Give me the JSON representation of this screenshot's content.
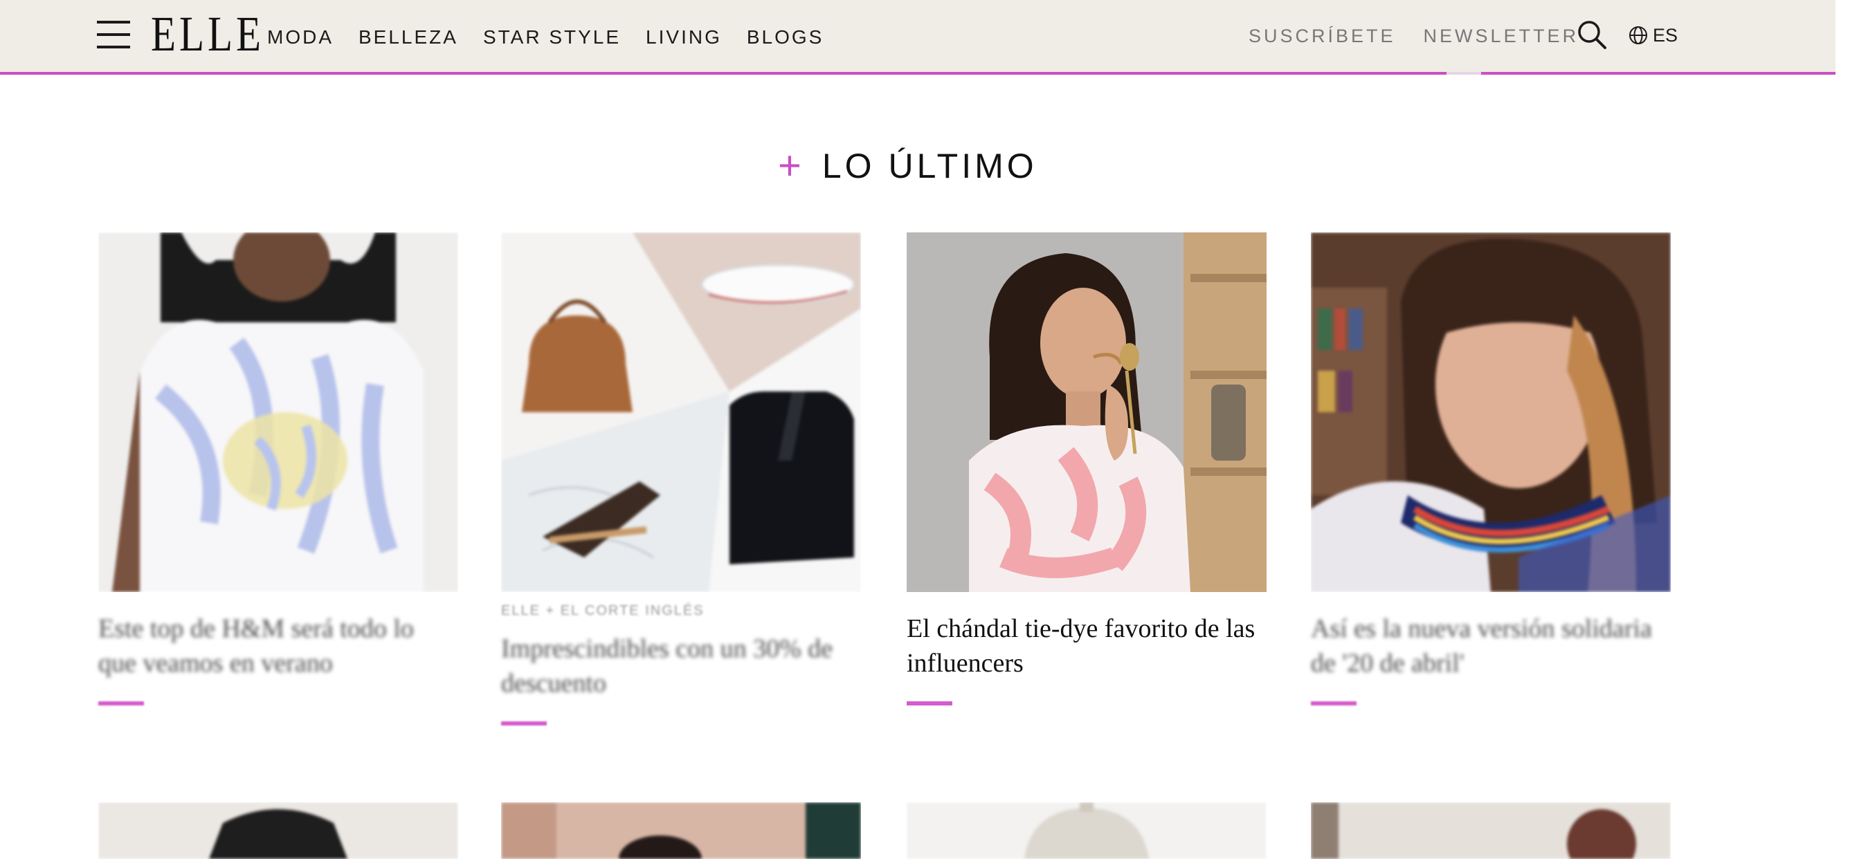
{
  "header": {
    "logo": "ELLE",
    "nav": [
      "MODA",
      "BELLEZA",
      "STAR STYLE",
      "LIVING",
      "BLOGS"
    ],
    "subscribe": "SUSCRÍBETE",
    "newsletter": "NEWSLETTER",
    "language": "ES",
    "icons": {
      "menu": "hamburger-menu-icon",
      "search": "search-icon",
      "language": "globe-icon"
    }
  },
  "section": {
    "title": "LO ÚLTIMO"
  },
  "articles": [
    {
      "title": "Este top de H&M será todo lo que veamos en verano",
      "kicker": ""
    },
    {
      "title": "Imprescindibles con un 30% de descuento",
      "kicker": "ELLE + EL CORTE INGLÉS"
    },
    {
      "title": "El chándal tie-dye favorito de las influencers",
      "kicker": ""
    },
    {
      "title": "Así es la nueva versión solidaria de '20 de abril'",
      "kicker": ""
    }
  ],
  "colors": {
    "accent": "#c94fc2",
    "header_bg": "#f0ece6"
  }
}
